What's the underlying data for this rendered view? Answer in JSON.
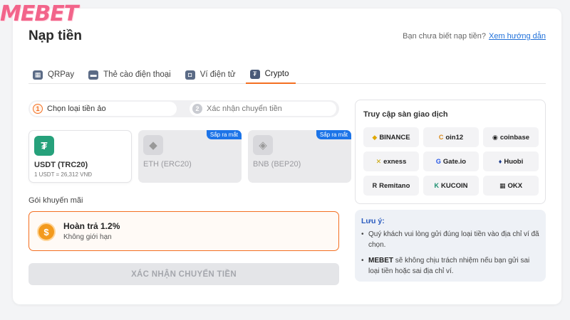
{
  "brand": {
    "logo_text": "MEBET"
  },
  "header": {
    "title": "Nạp tiền",
    "help_text": "Bạn chưa biết nạp tiền?",
    "help_link": "Xem hướng dẫn"
  },
  "tabs": [
    {
      "label": "QRPay",
      "icon": "qr-icon",
      "glyph": "▦"
    },
    {
      "label": "Thẻ cào điện thoại",
      "icon": "phone-card-icon",
      "glyph": "▬"
    },
    {
      "label": "Ví điện tử",
      "icon": "wallet-icon",
      "glyph": "◘"
    },
    {
      "label": "Crypto",
      "icon": "tether-icon",
      "glyph": "₮",
      "active": true
    }
  ],
  "steps": [
    {
      "num": "1",
      "label": "Chọn loại tiền ảo"
    },
    {
      "num": "2",
      "label": "Xác nhận chuyển tiền"
    }
  ],
  "coins": [
    {
      "name": "USDT (TRC20)",
      "rate": "1 USDT = 26,312 VNĐ",
      "glyph": "₮",
      "selected": true
    },
    {
      "name": "ETH (ERC20)",
      "glyph": "◆",
      "badge": "Sắp ra mắt"
    },
    {
      "name": "BNB (BEP20)",
      "glyph": "◈",
      "badge": "Sắp ra mắt"
    }
  ],
  "promo": {
    "section_title": "Gói khuyến mãi",
    "title": "Hoàn trả 1.2%",
    "subtitle": "Không giới hạn",
    "glyph": "$"
  },
  "confirm_label": "XÁC NHẬN CHUYỂN TIỀN",
  "exchanges": {
    "title": "Truy cập sàn giao dịch",
    "items": [
      {
        "label": "BINANCE",
        "mark": "◆",
        "color": "#e0a800"
      },
      {
        "label": "oin12",
        "mark": "C",
        "color": "#d98a1a"
      },
      {
        "label": "coinbase",
        "mark": "◉",
        "color": "#222222"
      },
      {
        "label": "exness",
        "mark": "✕",
        "color": "#c9a400"
      },
      {
        "label": "Gate.io",
        "mark": "G",
        "color": "#2354e6"
      },
      {
        "label": "Huobi",
        "mark": "♦",
        "color": "#1a3a8a"
      },
      {
        "label": "Remitano",
        "mark": "R",
        "color": "#222222"
      },
      {
        "label": "KUCOIN",
        "mark": "K",
        "color": "#1a8f6f"
      },
      {
        "label": "OKX",
        "mark": "▦",
        "color": "#222222"
      }
    ]
  },
  "note": {
    "title": "Lưu ý:",
    "item1": "Quý khách vui lòng gửi đúng loại tiền vào địa chỉ ví đã chọn.",
    "item2_brand": "MEBET",
    "item2": " sẽ không chịu trách nhiệm nếu bạn gửi sai loại tiền hoặc sai địa chỉ ví."
  },
  "colors": {
    "accent": "#f36f21",
    "link": "#1e6fd9",
    "badge": "#1c74e8",
    "tether": "#26a17b"
  }
}
